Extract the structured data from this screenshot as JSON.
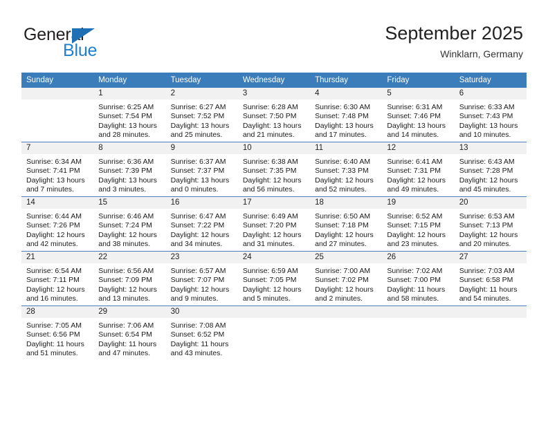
{
  "brand": {
    "name_part1": "General",
    "name_part2": "Blue",
    "logo_icon": "triangle-logo-icon",
    "accent_color": "#1f7fd0"
  },
  "header": {
    "month_title": "September 2025",
    "location": "Winklarn, Germany"
  },
  "theme": {
    "header_row_bg": "#3b7cba",
    "daynum_band_bg": "#f1f1f1",
    "grid_line": "#4a7ebb"
  },
  "calendar": {
    "weekday_headers": [
      "Sunday",
      "Monday",
      "Tuesday",
      "Wednesday",
      "Thursday",
      "Friday",
      "Saturday"
    ],
    "weeks": [
      [
        {
          "day": "",
          "blank": true,
          "sunrise": "",
          "sunset": "",
          "daylight1": "",
          "daylight2": ""
        },
        {
          "day": "1",
          "sunrise": "Sunrise: 6:25 AM",
          "sunset": "Sunset: 7:54 PM",
          "daylight1": "Daylight: 13 hours",
          "daylight2": "and 28 minutes."
        },
        {
          "day": "2",
          "sunrise": "Sunrise: 6:27 AM",
          "sunset": "Sunset: 7:52 PM",
          "daylight1": "Daylight: 13 hours",
          "daylight2": "and 25 minutes."
        },
        {
          "day": "3",
          "sunrise": "Sunrise: 6:28 AM",
          "sunset": "Sunset: 7:50 PM",
          "daylight1": "Daylight: 13 hours",
          "daylight2": "and 21 minutes."
        },
        {
          "day": "4",
          "sunrise": "Sunrise: 6:30 AM",
          "sunset": "Sunset: 7:48 PM",
          "daylight1": "Daylight: 13 hours",
          "daylight2": "and 17 minutes."
        },
        {
          "day": "5",
          "sunrise": "Sunrise: 6:31 AM",
          "sunset": "Sunset: 7:46 PM",
          "daylight1": "Daylight: 13 hours",
          "daylight2": "and 14 minutes."
        },
        {
          "day": "6",
          "sunrise": "Sunrise: 6:33 AM",
          "sunset": "Sunset: 7:43 PM",
          "daylight1": "Daylight: 13 hours",
          "daylight2": "and 10 minutes."
        }
      ],
      [
        {
          "day": "7",
          "sunrise": "Sunrise: 6:34 AM",
          "sunset": "Sunset: 7:41 PM",
          "daylight1": "Daylight: 13 hours",
          "daylight2": "and 7 minutes."
        },
        {
          "day": "8",
          "sunrise": "Sunrise: 6:36 AM",
          "sunset": "Sunset: 7:39 PM",
          "daylight1": "Daylight: 13 hours",
          "daylight2": "and 3 minutes."
        },
        {
          "day": "9",
          "sunrise": "Sunrise: 6:37 AM",
          "sunset": "Sunset: 7:37 PM",
          "daylight1": "Daylight: 13 hours",
          "daylight2": "and 0 minutes."
        },
        {
          "day": "10",
          "sunrise": "Sunrise: 6:38 AM",
          "sunset": "Sunset: 7:35 PM",
          "daylight1": "Daylight: 12 hours",
          "daylight2": "and 56 minutes."
        },
        {
          "day": "11",
          "sunrise": "Sunrise: 6:40 AM",
          "sunset": "Sunset: 7:33 PM",
          "daylight1": "Daylight: 12 hours",
          "daylight2": "and 52 minutes."
        },
        {
          "day": "12",
          "sunrise": "Sunrise: 6:41 AM",
          "sunset": "Sunset: 7:31 PM",
          "daylight1": "Daylight: 12 hours",
          "daylight2": "and 49 minutes."
        },
        {
          "day": "13",
          "sunrise": "Sunrise: 6:43 AM",
          "sunset": "Sunset: 7:28 PM",
          "daylight1": "Daylight: 12 hours",
          "daylight2": "and 45 minutes."
        }
      ],
      [
        {
          "day": "14",
          "sunrise": "Sunrise: 6:44 AM",
          "sunset": "Sunset: 7:26 PM",
          "daylight1": "Daylight: 12 hours",
          "daylight2": "and 42 minutes."
        },
        {
          "day": "15",
          "sunrise": "Sunrise: 6:46 AM",
          "sunset": "Sunset: 7:24 PM",
          "daylight1": "Daylight: 12 hours",
          "daylight2": "and 38 minutes."
        },
        {
          "day": "16",
          "sunrise": "Sunrise: 6:47 AM",
          "sunset": "Sunset: 7:22 PM",
          "daylight1": "Daylight: 12 hours",
          "daylight2": "and 34 minutes."
        },
        {
          "day": "17",
          "sunrise": "Sunrise: 6:49 AM",
          "sunset": "Sunset: 7:20 PM",
          "daylight1": "Daylight: 12 hours",
          "daylight2": "and 31 minutes."
        },
        {
          "day": "18",
          "sunrise": "Sunrise: 6:50 AM",
          "sunset": "Sunset: 7:18 PM",
          "daylight1": "Daylight: 12 hours",
          "daylight2": "and 27 minutes."
        },
        {
          "day": "19",
          "sunrise": "Sunrise: 6:52 AM",
          "sunset": "Sunset: 7:15 PM",
          "daylight1": "Daylight: 12 hours",
          "daylight2": "and 23 minutes."
        },
        {
          "day": "20",
          "sunrise": "Sunrise: 6:53 AM",
          "sunset": "Sunset: 7:13 PM",
          "daylight1": "Daylight: 12 hours",
          "daylight2": "and 20 minutes."
        }
      ],
      [
        {
          "day": "21",
          "sunrise": "Sunrise: 6:54 AM",
          "sunset": "Sunset: 7:11 PM",
          "daylight1": "Daylight: 12 hours",
          "daylight2": "and 16 minutes."
        },
        {
          "day": "22",
          "sunrise": "Sunrise: 6:56 AM",
          "sunset": "Sunset: 7:09 PM",
          "daylight1": "Daylight: 12 hours",
          "daylight2": "and 13 minutes."
        },
        {
          "day": "23",
          "sunrise": "Sunrise: 6:57 AM",
          "sunset": "Sunset: 7:07 PM",
          "daylight1": "Daylight: 12 hours",
          "daylight2": "and 9 minutes."
        },
        {
          "day": "24",
          "sunrise": "Sunrise: 6:59 AM",
          "sunset": "Sunset: 7:05 PM",
          "daylight1": "Daylight: 12 hours",
          "daylight2": "and 5 minutes."
        },
        {
          "day": "25",
          "sunrise": "Sunrise: 7:00 AM",
          "sunset": "Sunset: 7:02 PM",
          "daylight1": "Daylight: 12 hours",
          "daylight2": "and 2 minutes."
        },
        {
          "day": "26",
          "sunrise": "Sunrise: 7:02 AM",
          "sunset": "Sunset: 7:00 PM",
          "daylight1": "Daylight: 11 hours",
          "daylight2": "and 58 minutes."
        },
        {
          "day": "27",
          "sunrise": "Sunrise: 7:03 AM",
          "sunset": "Sunset: 6:58 PM",
          "daylight1": "Daylight: 11 hours",
          "daylight2": "and 54 minutes."
        }
      ],
      [
        {
          "day": "28",
          "sunrise": "Sunrise: 7:05 AM",
          "sunset": "Sunset: 6:56 PM",
          "daylight1": "Daylight: 11 hours",
          "daylight2": "and 51 minutes."
        },
        {
          "day": "29",
          "sunrise": "Sunrise: 7:06 AM",
          "sunset": "Sunset: 6:54 PM",
          "daylight1": "Daylight: 11 hours",
          "daylight2": "and 47 minutes."
        },
        {
          "day": "30",
          "sunrise": "Sunrise: 7:08 AM",
          "sunset": "Sunset: 6:52 PM",
          "daylight1": "Daylight: 11 hours",
          "daylight2": "and 43 minutes."
        },
        {
          "day": "",
          "blank": true,
          "sunrise": "",
          "sunset": "",
          "daylight1": "",
          "daylight2": ""
        },
        {
          "day": "",
          "blank": true,
          "sunrise": "",
          "sunset": "",
          "daylight1": "",
          "daylight2": ""
        },
        {
          "day": "",
          "blank": true,
          "sunrise": "",
          "sunset": "",
          "daylight1": "",
          "daylight2": ""
        },
        {
          "day": "",
          "blank": true,
          "sunrise": "",
          "sunset": "",
          "daylight1": "",
          "daylight2": ""
        }
      ]
    ]
  }
}
